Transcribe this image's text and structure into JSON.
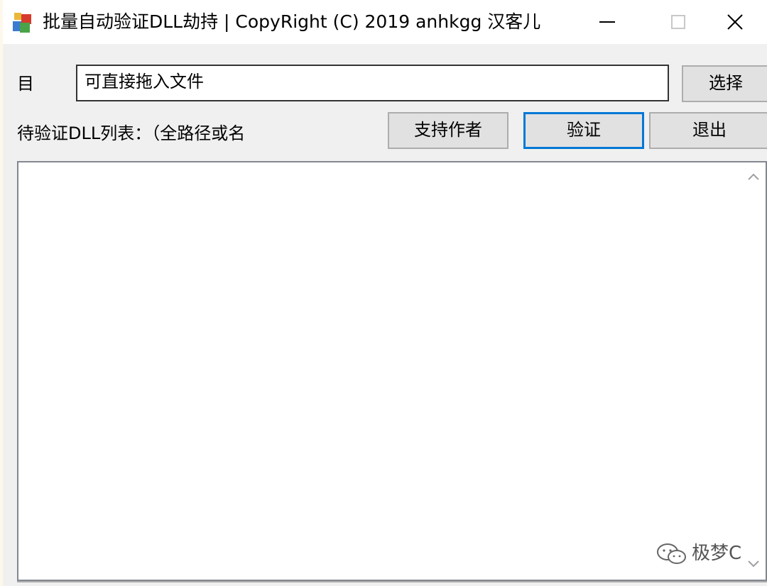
{
  "window": {
    "title": "批量自动验证DLL劫持 | CopyRight (C) 2019 anhkgg 汉客儿",
    "icons": [
      "app-icon",
      "minimize-icon",
      "maximize-icon",
      "close-icon"
    ]
  },
  "target": {
    "label": "目",
    "input_value": "可直接拖入文件",
    "select_button": "选择"
  },
  "list": {
    "label": "待验证DLL列表：（全路径或名"
  },
  "buttons": {
    "support": "支持作者",
    "verify": "验证",
    "exit": "退出"
  },
  "scrollbar": {
    "icons": [
      "chevron-up-icon",
      "chevron-down-icon"
    ]
  },
  "watermark": {
    "text": "极梦C",
    "icon": "wechat-icon"
  },
  "colors": {
    "focus_border": "#0078d7",
    "button_bg": "#e1e1e1",
    "window_bg": "#f0f0f0"
  }
}
